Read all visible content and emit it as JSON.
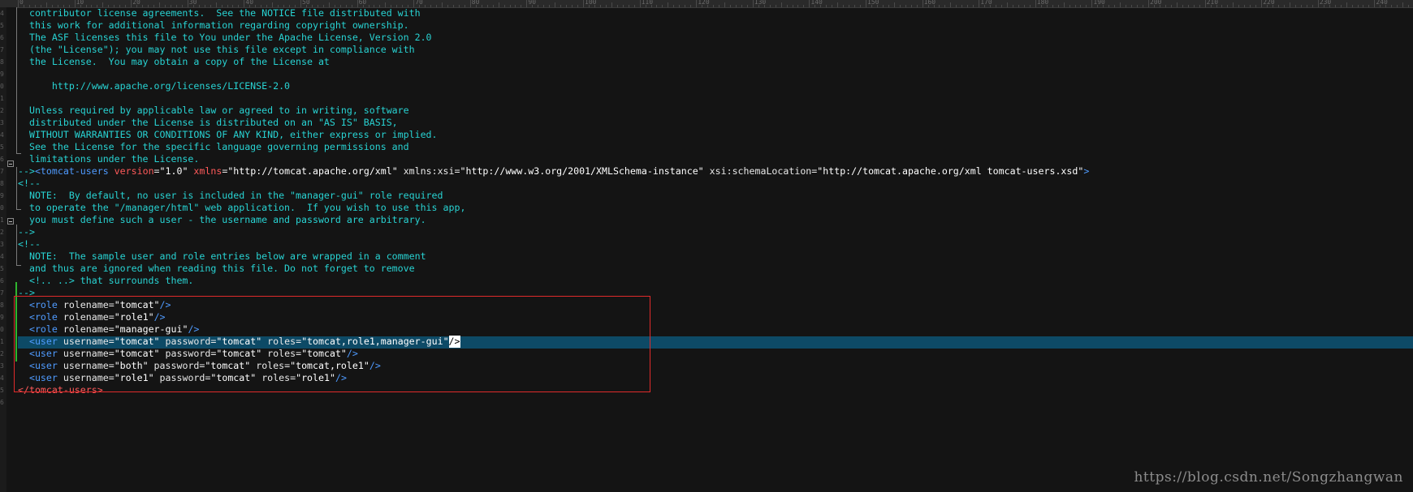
{
  "ruler": {
    "marks": [
      "0",
      "10",
      "20",
      "30",
      "40",
      "50",
      "60",
      "70",
      "80",
      "90",
      "100",
      "110",
      "120",
      "130",
      "140",
      "150",
      "160",
      "170",
      "180",
      "190",
      "200",
      "210",
      "220",
      "230",
      "240"
    ]
  },
  "gutter": {
    "numbers": [
      "4",
      "5",
      "6",
      "7",
      "8",
      "9",
      "0",
      "1",
      "2",
      "3",
      "4",
      "5",
      "6",
      "7",
      "8",
      "9",
      "0",
      "1",
      "2",
      "3",
      "4",
      "5",
      "6",
      "7",
      "8",
      "9",
      "0",
      "1",
      "2",
      "3",
      "4",
      "5",
      "6"
    ]
  },
  "code": {
    "l1": "  contributor license agreements.  See the NOTICE file distributed with",
    "l2": "  this work for additional information regarding copyright ownership.",
    "l3": "  The ASF licenses this file to You under the Apache License, Version 2.0",
    "l4": "  (the \"License\"); you may not use this file except in compliance with",
    "l5": "  the License.  You may obtain a copy of the License at",
    "l6": "",
    "l7": "      http://www.apache.org/licenses/LICENSE-2.0",
    "l8": "",
    "l9": "  Unless required by applicable law or agreed to in writing, software",
    "l10": "  distributed under the License is distributed on an \"AS IS\" BASIS,",
    "l11": "  WITHOUT WARRANTIES OR CONDITIONS OF ANY KIND, either express or implied.",
    "l12": "  See the License for the specific language governing permissions and",
    "l13": "  limitations under the License.",
    "l14": {
      "comment_end": "-->",
      "tag_open": "<tomcat-users",
      "attr_version": " version",
      "eq1": "=",
      "val_version": "\"1.0\"",
      "attr_xmlns": " xmlns",
      "eq2": "=",
      "val_xmlns": "\"http://tomcat.apache.org/xml\"",
      "attr_xsi": " xmlns:xsi",
      "eq3": "=",
      "val_xsi": "\"http://www.w3.org/2001/XMLSchema-instance\"",
      "attr_schema": " xsi:schemaLocation",
      "eq4": "=",
      "val_schema": "\"http://tomcat.apache.org/xml tomcat-users.xsd\"",
      "tag_close": ">"
    },
    "l15": "<!--",
    "l16": "  NOTE:  By default, no user is included in the \"manager-gui\" role required",
    "l17": "  to operate the \"/manager/html\" web application.  If you wish to use this app,",
    "l18": "  you must define such a user - the username and password are arbitrary.",
    "l19": "-->",
    "l20": "<!--",
    "l21": "  NOTE:  The sample user and role entries below are wrapped in a comment",
    "l22": "  and thus are ignored when reading this file. Do not forget to remove",
    "l23": "  <!.. ..> that surrounds them.",
    "l24": "-->",
    "roles": [
      {
        "tag": "<role",
        "attr": " rolename",
        "eq": "=",
        "val": "\"tomcat\"",
        "close": "/>"
      },
      {
        "tag": "<role",
        "attr": " rolename",
        "eq": "=",
        "val": "\"role1\"",
        "close": "/>"
      },
      {
        "tag": "<role",
        "attr": " rolename",
        "eq": "=",
        "val": "\"manager-gui\"",
        "close": "/>"
      }
    ],
    "users": [
      {
        "tag": "<user",
        "a1": " username",
        "v1": "\"tomcat\"",
        "a2": " password",
        "v2": "\"tomcat\"",
        "a3": " roles",
        "v3": "\"tomcat,role1,manager-gui\"",
        "close": "/>"
      },
      {
        "tag": "<user",
        "a1": " username",
        "v1": "\"tomcat\"",
        "a2": " password",
        "v2": "\"tomcat\"",
        "a3": " roles",
        "v3": "\"tomcat\"",
        "close": "/>"
      },
      {
        "tag": "<user",
        "a1": " username",
        "v1": "\"both\"",
        "a2": " password",
        "v2": "\"tomcat\"",
        "a3": " roles",
        "v3": "\"tomcat,role1\"",
        "close": "/>"
      },
      {
        "tag": "<user",
        "a1": " username",
        "v1": "\"role1\"",
        "a2": " password",
        "v2": "\"tomcat\"",
        "a3": " roles",
        "v3": "\"role1\"",
        "close": "/>"
      }
    ],
    "eq": "=",
    "indent": "  ",
    "closing_tag": "</tomcat-users>"
  },
  "watermark": "https://blog.csdn.net/Songzhangwan",
  "colors": {
    "background": "#141414",
    "comment": "#28d3d3",
    "tag": "#4f9bff",
    "attribute_red": "#ff5a5a",
    "selection": "#0d4a66",
    "annotation_box": "#e02b2b"
  }
}
